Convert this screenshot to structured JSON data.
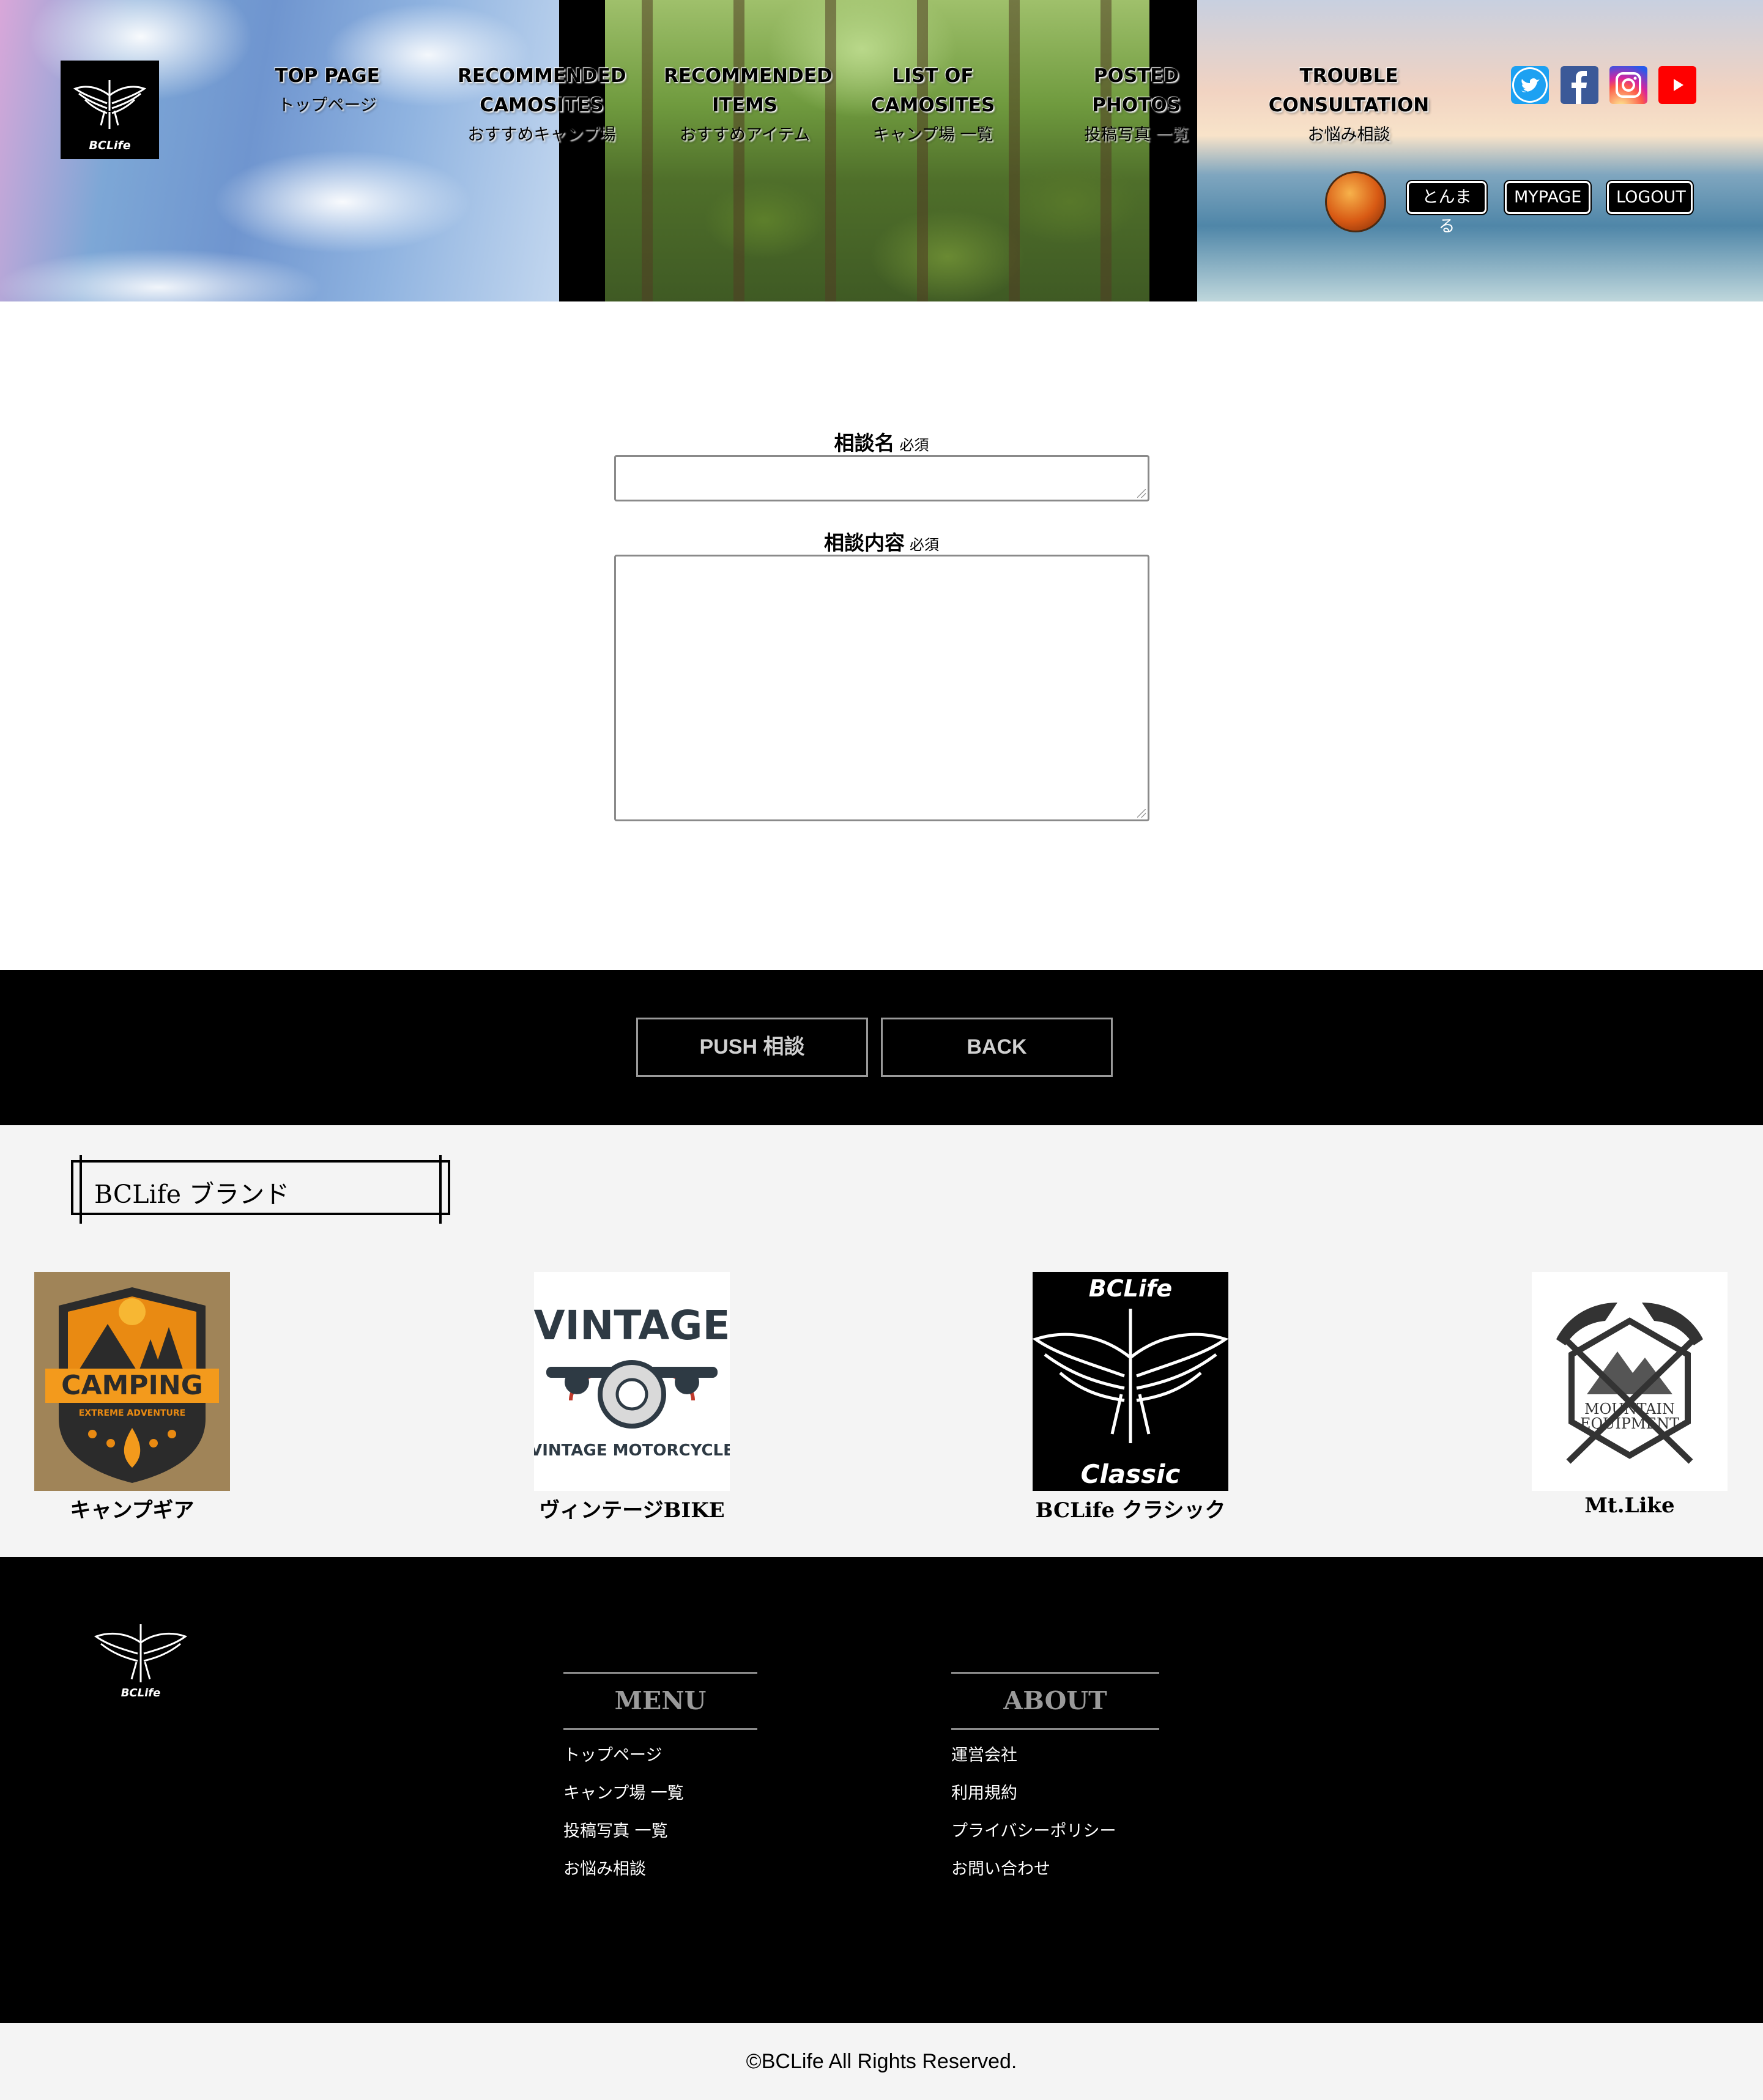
{
  "header": {
    "logo_text": "BCLife",
    "nav": [
      {
        "en": "TOP PAGE",
        "ja": "トップページ"
      },
      {
        "en": "RECOMMENDED CAMOSITES",
        "ja": "おすすめキャンプ場"
      },
      {
        "en": "RECOMMENDED ITEMS",
        "ja": "おすすめアイテム"
      },
      {
        "en": "LIST OF CAMOSITES",
        "ja": "キャンプ場 一覧"
      },
      {
        "en": "POSTED PHOTOS",
        "ja": "投稿写真 一覧"
      },
      {
        "en": "TROUBLE CONSULTATION",
        "ja": "お悩み相談"
      }
    ],
    "social": [
      "twitter-icon",
      "facebook-icon",
      "instagram-icon",
      "youtube-icon"
    ],
    "user_name": "とんまる",
    "mypage_label": "MYPAGE",
    "logout_label": "LOGOUT"
  },
  "form": {
    "title_label": "相談名",
    "title_required": "必須",
    "title_value": "",
    "body_label": "相談内容",
    "body_required": "必須",
    "body_value": ""
  },
  "actions": {
    "submit_label": "PUSH 相談",
    "back_label": "BACK"
  },
  "brands": {
    "heading": "BCLife ブランド",
    "items": [
      {
        "name": "キャンプギア",
        "logo_text": "CAMPING",
        "logo_sub": "EXTREME ADVENTURE"
      },
      {
        "name": "ヴィンテージBIKE",
        "logo_text": "VINTAGE",
        "logo_sub": "VINTAGE MOTORCYCLE"
      },
      {
        "name": "BCLife クラシック",
        "logo_text": "BCLife",
        "logo_sub": "Classic"
      },
      {
        "name": "Mt.Like",
        "logo_text": "MOUNTAIN",
        "logo_sub": "EQUIPMENT"
      }
    ]
  },
  "footer": {
    "logo_text": "BCLife",
    "menu_heading": "MENU",
    "menu_links": [
      "トップページ",
      "キャンプ場 一覧",
      "投稿写真 一覧",
      "お悩み相談"
    ],
    "about_heading": "ABOUT",
    "about_links": [
      "運営会社",
      "利用規約",
      "プライバシーポリシー",
      "お問い合わせ"
    ]
  },
  "copyright": "©BCLife All Rights Reserved.",
  "colors": {
    "header_bg": "#000000",
    "action_bar_bg": "#000000",
    "brand_bg": "#f4f4f4",
    "twitter": "#1da1f2",
    "facebook": "#3b5998",
    "youtube": "#ff0000",
    "camping_orange": "#e98a12"
  }
}
